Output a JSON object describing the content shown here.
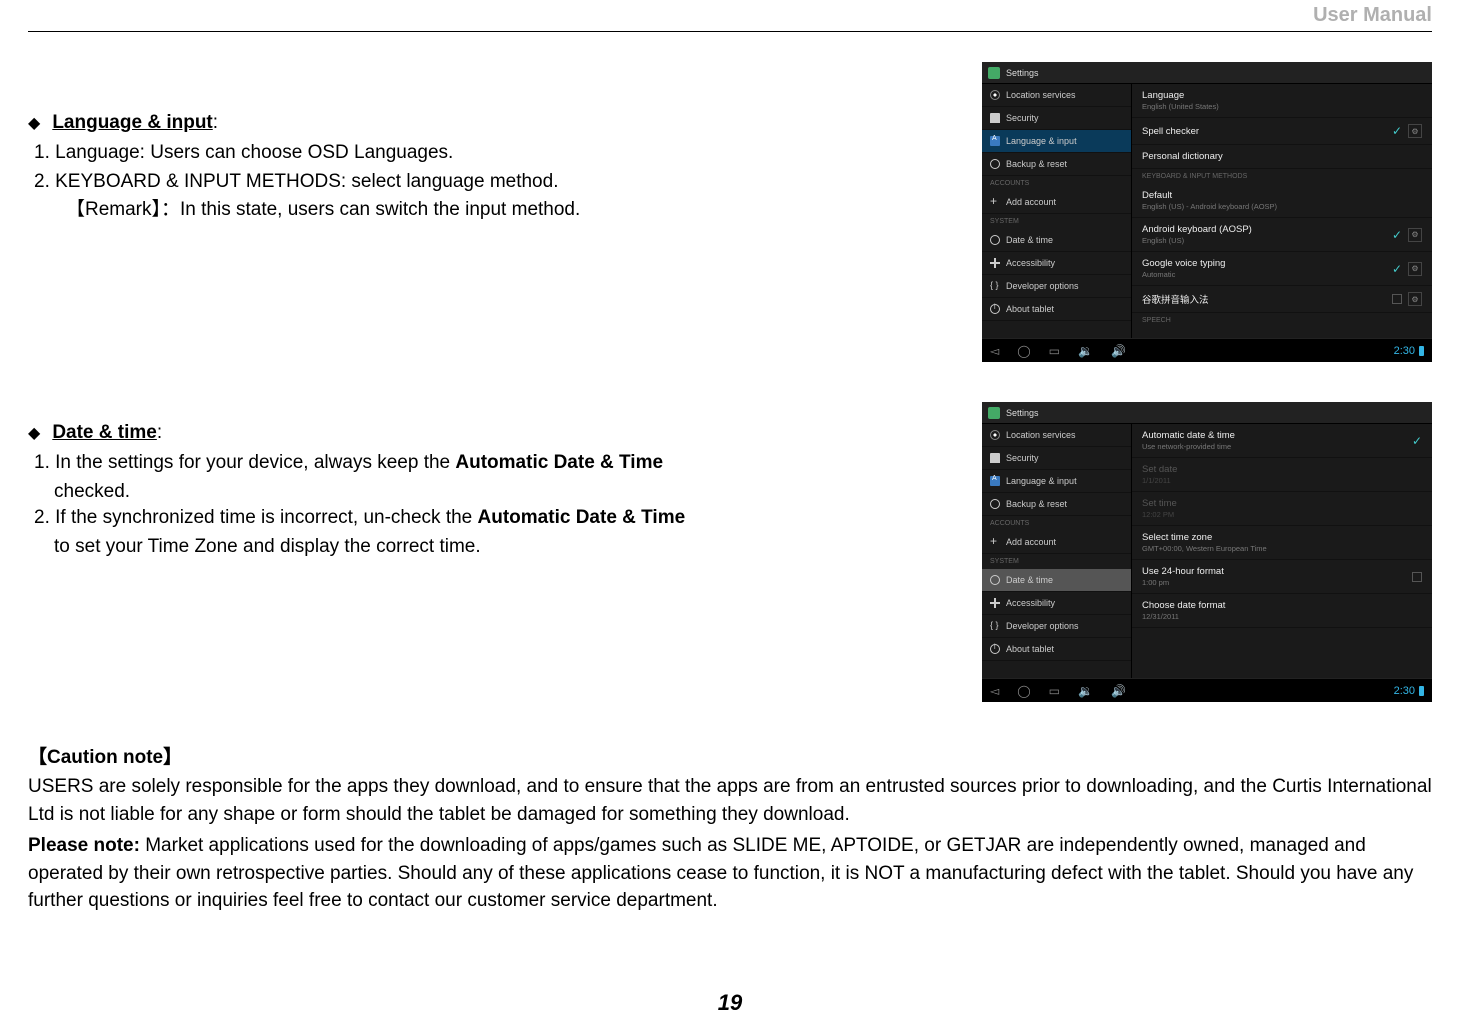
{
  "header": {
    "title": "User Manual"
  },
  "section1": {
    "heading": "Language & input",
    "item1": "1.  Language: Users can choose OSD Languages.",
    "item2": "2.  KEYBOARD & INPUT METHODS: select language method.",
    "remark": "【Remark】：In this state, users can switch the input method."
  },
  "section2": {
    "heading": "Date & time",
    "item1_pre": "1. In the settings for your device, always keep the ",
    "item1_bold": "Automatic Date & Time",
    "item1_post_line": "checked.",
    "item2_pre": "2. If the synchronized time is incorrect, un-check the ",
    "item2_bold": "Automatic Date & Time",
    "item2_post_line": "to set your Time Zone and display the correct time."
  },
  "caution": {
    "heading": "【Caution note】",
    "body1": "USERS are solely responsible for the apps they download, and to ensure that the apps are from an entrusted sources prior to downloading, and the Curtis International Ltd is not liable for any shape or form should the   tablet be damaged for something they download.",
    "note_bold": "Please note:",
    "note_rest": " Market applications used for the downloading of apps/games such as SLIDE ME, APTOIDE, or GETJAR are independently owned, managed and operated by their own retrospective parties. Should any of these applications cease to function, it is NOT a manufacturing defect with the tablet. Should you have any further questions or inquiries feel free to contact our customer service department."
  },
  "page_number": "19",
  "screenshot1": {
    "title": "Settings",
    "sidebar": {
      "items": [
        {
          "icon": "location",
          "label": "Location services"
        },
        {
          "icon": "lock",
          "label": "Security"
        },
        {
          "icon": "lang",
          "label": "Language & input",
          "active": "blue"
        },
        {
          "icon": "backup",
          "label": "Backup & reset"
        }
      ],
      "cat1": "ACCOUNTS",
      "items2": [
        {
          "icon": "plus",
          "label": "Add account"
        }
      ],
      "cat2": "SYSTEM",
      "items3": [
        {
          "icon": "clock",
          "label": "Date & time"
        },
        {
          "icon": "hand",
          "label": "Accessibility"
        },
        {
          "icon": "dev",
          "label": "Developer options"
        },
        {
          "icon": "about",
          "label": "About tablet"
        }
      ]
    },
    "content": {
      "rows": [
        {
          "main": "Language",
          "sub": "English (United States)"
        },
        {
          "main": "Spell checker",
          "right": "settings",
          "check": true
        },
        {
          "main": "Personal dictionary"
        }
      ],
      "cat": "KEYBOARD & INPUT METHODS",
      "rows2": [
        {
          "main": "Default",
          "sub": "English (US) - Android keyboard (AOSP)"
        },
        {
          "main": "Android keyboard (AOSP)",
          "sub": "English (US)",
          "right": "settings",
          "check": true
        },
        {
          "main": "Google voice typing",
          "sub": "Automatic",
          "right": "settings",
          "check": true
        },
        {
          "main": "谷歌拼音输入法",
          "right": "settings",
          "check": false
        }
      ],
      "cat2": "SPEECH"
    },
    "navbar": {
      "time": "2:30"
    }
  },
  "screenshot2": {
    "title": "Settings",
    "sidebar": {
      "items": [
        {
          "icon": "location",
          "label": "Location services"
        },
        {
          "icon": "lock",
          "label": "Security"
        },
        {
          "icon": "lang",
          "label": "Language & input"
        },
        {
          "icon": "backup",
          "label": "Backup & reset"
        }
      ],
      "cat1": "ACCOUNTS",
      "items2": [
        {
          "icon": "plus",
          "label": "Add account"
        }
      ],
      "cat2": "SYSTEM",
      "items3": [
        {
          "icon": "clock",
          "label": "Date & time",
          "active": "grey"
        },
        {
          "icon": "hand",
          "label": "Accessibility"
        },
        {
          "icon": "dev",
          "label": "Developer options"
        },
        {
          "icon": "about",
          "label": "About tablet"
        }
      ]
    },
    "content": {
      "rows": [
        {
          "main": "Automatic date & time",
          "sub": "Use network-provided time",
          "check_blue": true
        },
        {
          "main": "Set date",
          "sub": "1/1/2011",
          "dim": true
        },
        {
          "main": "Set time",
          "sub": "12:02 PM",
          "dim": true
        },
        {
          "main": "Select time zone",
          "sub": "GMT+00:00, Western European Time"
        },
        {
          "main": "Use 24-hour format",
          "sub": "1:00 pm",
          "check_empty": true
        },
        {
          "main": "Choose date format",
          "sub": "12/31/2011"
        }
      ]
    },
    "navbar": {
      "time": "2:30"
    }
  }
}
